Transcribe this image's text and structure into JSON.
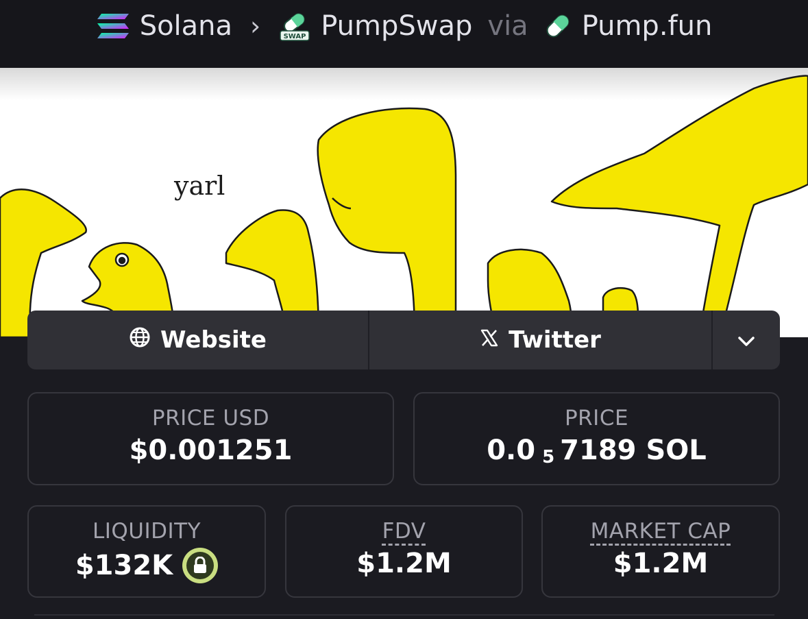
{
  "breadcrumb": {
    "chain": "Solana",
    "dex": "PumpSwap",
    "via_word": "via",
    "launchpad": "Pump.fun",
    "chain_icon": "solana-logo-icon",
    "dex_icon": "pumpswap-logo-icon",
    "dex_icon_badge": "SWAP",
    "launchpad_icon": "pill-icon"
  },
  "banner": {
    "caption": "yarl",
    "accent_color": "#f5e600"
  },
  "links": {
    "website_label": "Website",
    "website_icon": "globe-icon",
    "twitter_label": "Twitter",
    "twitter_icon": "x-logo-icon",
    "more_icon": "chevron-down-icon"
  },
  "stats": {
    "price_usd": {
      "label": "PRICE USD",
      "value": "$0.001251"
    },
    "price": {
      "label": "PRICE",
      "prefix": "0.0",
      "zeros": "5",
      "digits": "7189",
      "unit": "SOL"
    },
    "liquidity": {
      "label": "LIQUIDITY",
      "value": "$132K",
      "icon": "lock-icon",
      "icon_color": "#c9de81"
    },
    "fdv": {
      "label": "FDV",
      "value": "$1.2M"
    },
    "market_cap": {
      "label": "MARKET CAP",
      "value": "$1.2M"
    }
  }
}
